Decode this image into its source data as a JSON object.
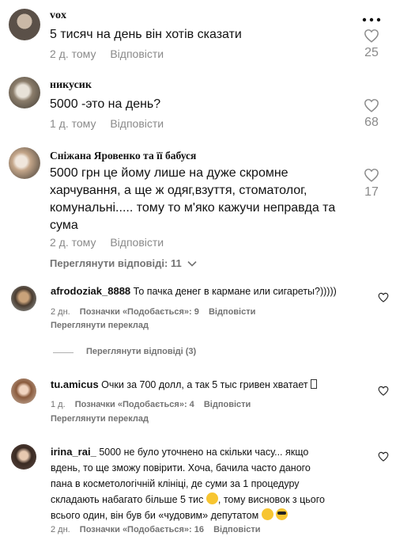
{
  "comments": [
    {
      "author": "vox",
      "text": "5 тисяч на день він хотів сказати",
      "time": "2 д. тому",
      "reply": "Відповісти",
      "likes": "25"
    },
    {
      "author": "никусик",
      "text": "5000 -это на день?",
      "time": "1 д. тому",
      "reply": "Відповісти",
      "likes": "68"
    },
    {
      "author": "Сніжана Яровенко та її бабуся",
      "text_lines": [
        "5000 грн це йому лише на дуже скромне",
        "харчування, а ще ж одяг,взуття, стоматолог,",
        "комунальні..... тому то м'яко кажучи неправда та",
        "сума"
      ],
      "time": "2 д. тому",
      "reply": "Відповісти",
      "likes": "17",
      "view_replies": "Переглянути відповіді: 11"
    }
  ],
  "ig_comments": [
    {
      "author": "afrodoziak_8888",
      "text": "То пачка денег в кармане или сигареты?))))) ",
      "time": "2 дн.",
      "likes_label": "Позначки «Подобається»: 9",
      "reply": "Відповісти",
      "translate": "Переглянути переклад",
      "view_replies": "Переглянути відповіді (3)"
    },
    {
      "author": "tu.amicus",
      "text": "Очки за 700 долл, а так 5 тыс гривен хватает",
      "time": "1 д.",
      "likes_label": "Позначки «Подобається»: 4",
      "reply": "Відповісти",
      "translate": "Переглянути переклад"
    },
    {
      "author": "irina_rai_",
      "text_lines": [
        "5000 не було уточнено на скільки часу... якщо",
        "вдень, то ще зможу повірити. Хоча, бачила часто даного",
        "пана в косметологічній клініці, де суми за 1 процедуру",
        "складають набагато більше 5 тис",
        ", тому висновок з цього",
        "всього один, він був би «чудовим» депутатом"
      ],
      "time": "2 дн.",
      "likes_label": "Позначки «Подобається»: 16",
      "reply": "Відповісти"
    }
  ],
  "icons": {
    "more": "more-dots-icon",
    "like": "heart-outline-icon",
    "chevron": "chevron-down-icon"
  }
}
